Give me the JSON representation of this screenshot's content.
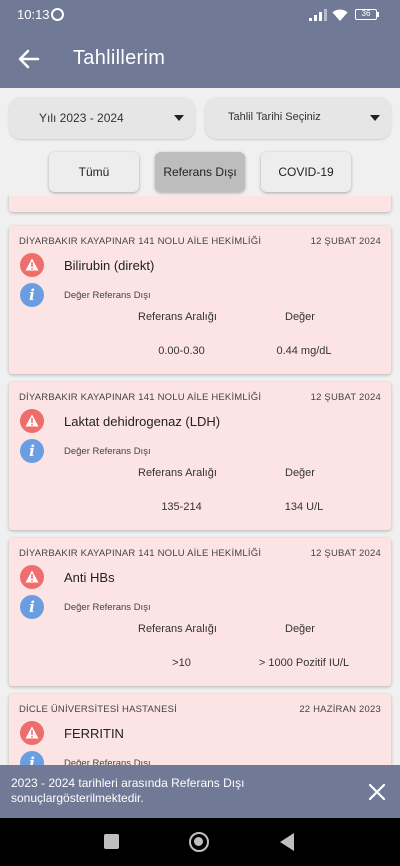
{
  "status_bar": {
    "time": "10:13",
    "battery": "36"
  },
  "app_bar": {
    "title": "Tahlillerim"
  },
  "filters": {
    "year_select": "Yılı 2023 - 2024",
    "date_select": "Tahlil Tarihi Seçiniz",
    "tabs": [
      {
        "label": "Tümü",
        "active": false
      },
      {
        "label": "Referans Dışı",
        "active": true
      },
      {
        "label": "COVID-19",
        "active": false
      }
    ]
  },
  "labels": {
    "status": "Değer Referans Dışı",
    "range_header": "Referans Aralığı",
    "value_header": "Değer"
  },
  "results": [
    {
      "hospital": "DİYARBAKIR KAYAPINAR 141 NOLU AİLE HEKİMLİĞİ",
      "date": "12 ŞUBAT 2024",
      "test": "Bilirubin (direkt)",
      "range": "0.00-0.30",
      "value": "0.44 mg/dL"
    },
    {
      "hospital": "DİYARBAKIR KAYAPINAR 141 NOLU AİLE HEKİMLİĞİ",
      "date": "12 ŞUBAT 2024",
      "test": "Laktat dehidrogenaz (LDH)",
      "range": "135-214",
      "value": "134 U/L"
    },
    {
      "hospital": "DİYARBAKIR KAYAPINAR 141 NOLU AİLE HEKİMLİĞİ",
      "date": "12 ŞUBAT 2024",
      "test": "Anti HBs",
      "range": ">10",
      "value": "> 1000 Pozitif IU/L"
    },
    {
      "hospital": "DİCLE ÜNİVERSİTESİ HASTANESİ",
      "date": "22 HAZİRAN 2023",
      "test": "FERRITIN",
      "range": "",
      "value": ""
    }
  ],
  "snackbar": {
    "message": "2023 - 2024 tarihleri arasında Referans Dışı sonuçlargösterilmektedir."
  },
  "colors": {
    "bar": "#707a96",
    "card": "#fce4e4",
    "warning": "#ee6d6d",
    "info": "#6a9ee0"
  }
}
